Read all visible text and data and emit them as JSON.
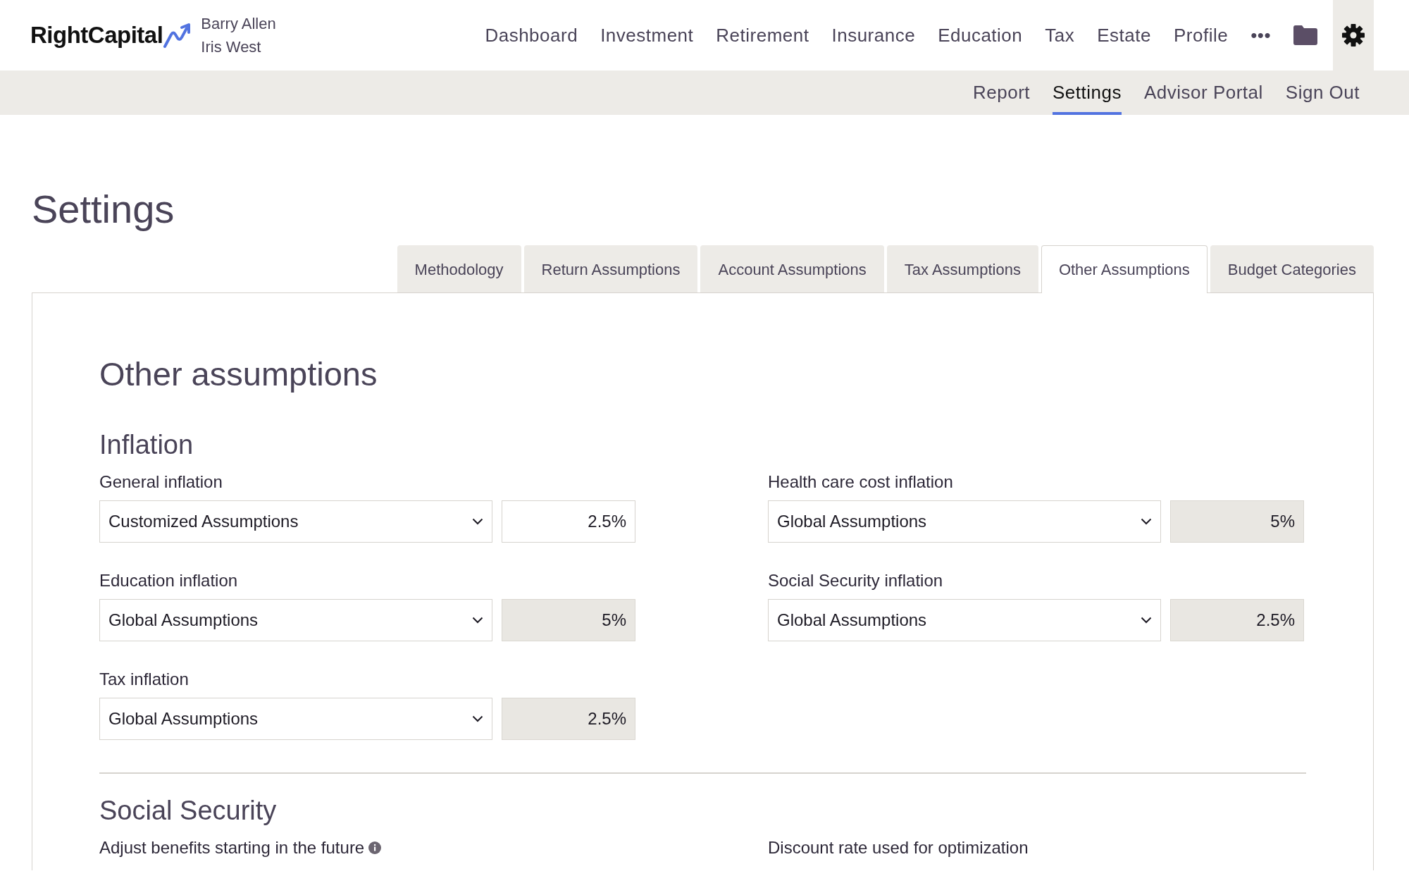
{
  "brand": {
    "name": "RightCapital",
    "clients": [
      "Barry Allen",
      "Iris West"
    ]
  },
  "main_nav": [
    "Dashboard",
    "Investment",
    "Retirement",
    "Insurance",
    "Education",
    "Tax",
    "Estate",
    "Profile",
    "•••"
  ],
  "sub_nav": [
    {
      "label": "Report",
      "selected": false
    },
    {
      "label": "Settings",
      "selected": true
    },
    {
      "label": "Advisor Portal",
      "selected": false
    },
    {
      "label": "Sign Out",
      "selected": false
    }
  ],
  "page_title": "Settings",
  "tabs": [
    {
      "label": "Methodology",
      "selected": false
    },
    {
      "label": "Return Assumptions",
      "selected": false
    },
    {
      "label": "Account Assumptions",
      "selected": false
    },
    {
      "label": "Tax Assumptions",
      "selected": false
    },
    {
      "label": "Other Assumptions",
      "selected": true
    },
    {
      "label": "Budget Categories",
      "selected": false
    }
  ],
  "panel": {
    "title": "Other assumptions",
    "sections": [
      {
        "title": "Inflation",
        "fields": [
          {
            "label": "General inflation",
            "source": "Customized Assumptions",
            "value": "2.5%",
            "disabled": false
          },
          {
            "label": "Health care cost inflation",
            "source": "Global Assumptions",
            "value": "5%",
            "disabled": true
          },
          {
            "label": "Education inflation",
            "source": "Global Assumptions",
            "value": "5%",
            "disabled": true
          },
          {
            "label": "Social Security inflation",
            "source": "Global Assumptions",
            "value": "2.5%",
            "disabled": true
          },
          {
            "label": "Tax inflation",
            "source": "Global Assumptions",
            "value": "2.5%",
            "disabled": true
          }
        ]
      },
      {
        "title": "Social Security",
        "fields": [
          {
            "label": "Adjust benefits starting in the future",
            "info": true
          },
          {
            "label": "Discount rate used for optimization",
            "info": false
          }
        ]
      }
    ]
  }
}
